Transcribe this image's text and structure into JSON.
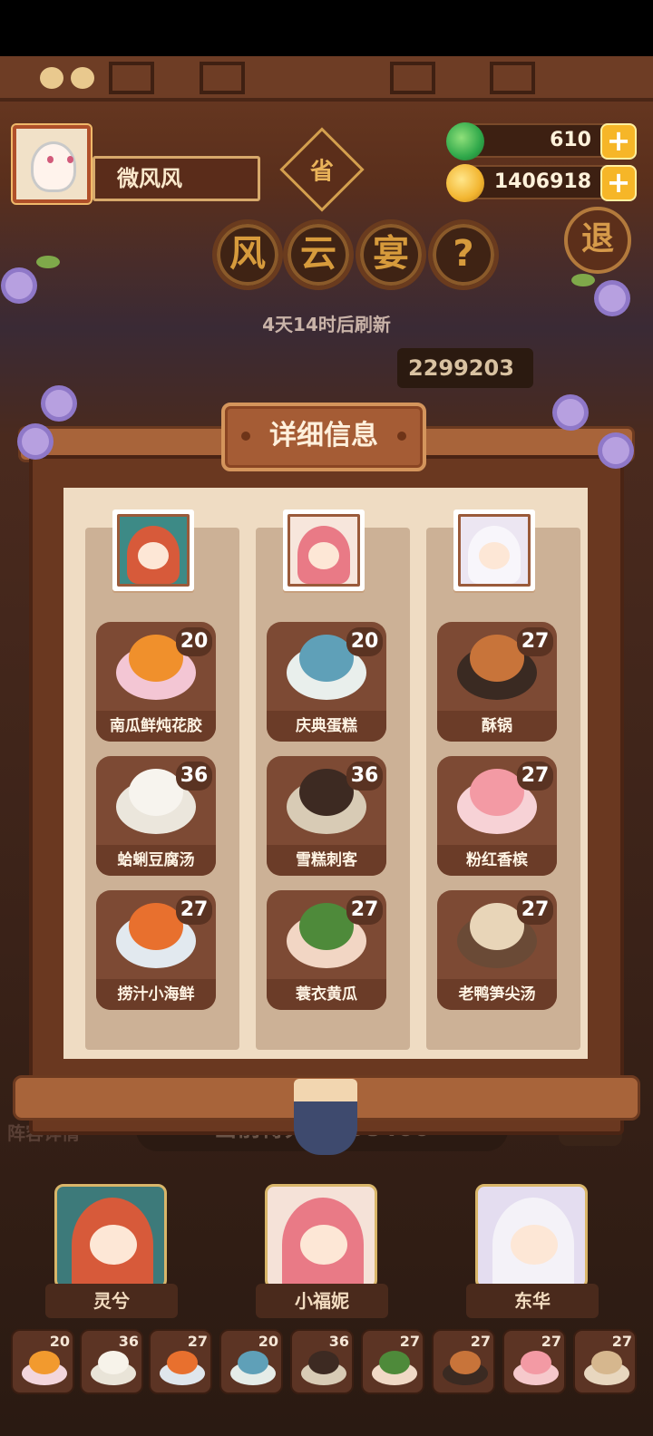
{
  "player": {
    "name": "微风风",
    "province_badge": "省"
  },
  "currency": {
    "jade": "610",
    "gold": "1406918",
    "plus_label": "+"
  },
  "exit_label": "退",
  "event": {
    "title_chars": [
      "风",
      "云",
      "宴"
    ],
    "help_label": "?",
    "refresh_text": "4天14时后刷新",
    "top_score": "2299203"
  },
  "panel": {
    "title": "详细信息",
    "columns": [
      {
        "hero": "灵兮",
        "dishes": [
          {
            "name": "南瓜鲜炖花胶",
            "level": "20"
          },
          {
            "name": "蛤蜊豆腐汤",
            "level": "36"
          },
          {
            "name": "捞汁小海鲜",
            "level": "27"
          }
        ]
      },
      {
        "hero": "小福妮",
        "dishes": [
          {
            "name": "庆典蛋糕",
            "level": "20"
          },
          {
            "name": "雪糕刺客",
            "level": "36"
          },
          {
            "name": "蓑衣黄瓜",
            "level": "27"
          }
        ]
      },
      {
        "hero": "东华",
        "dishes": [
          {
            "name": "酥锅",
            "level": "27"
          },
          {
            "name": "粉红香槟",
            "level": "27"
          },
          {
            "name": "老鸭笋尖汤",
            "level": "27"
          }
        ]
      }
    ]
  },
  "lower": {
    "lineup_label": "阵容详情",
    "current_score": "当前得分：158400",
    "heroes": [
      "灵兮",
      "小福妮",
      "东华"
    ],
    "mini_levels": [
      "20",
      "36",
      "27",
      "20",
      "36",
      "27",
      "27",
      "27",
      "27"
    ]
  },
  "colors": {
    "wood": "#6e3d25",
    "paper": "#efdcc3",
    "gold": "#f6b628",
    "jade": "#2fa84a"
  }
}
